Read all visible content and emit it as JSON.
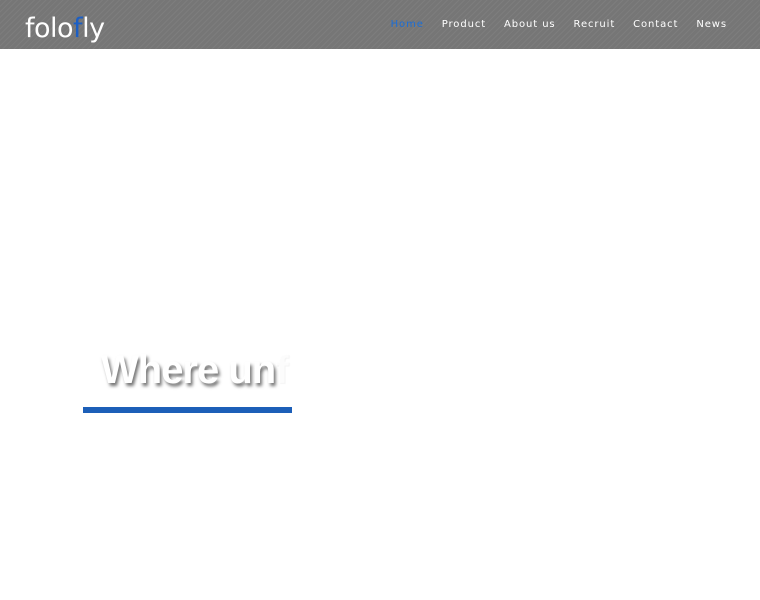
{
  "logo": {
    "part1": "folo",
    "accent": "f",
    "part2": "ly"
  },
  "nav": {
    "items": [
      {
        "label": "Home",
        "active": true
      },
      {
        "label": "Product",
        "active": false
      },
      {
        "label": "About us",
        "active": false
      },
      {
        "label": "Recruit",
        "active": false
      },
      {
        "label": "Contact",
        "active": false
      },
      {
        "label": "News",
        "active": false
      }
    ]
  },
  "hero": {
    "visible_text": "Where un",
    "partial_char": "f"
  },
  "colors": {
    "navbar_bg": "#767676",
    "accent_blue": "#1c5fc4",
    "active_nav": "#1c6ed6",
    "hero_bar": "#1c5fb8"
  }
}
